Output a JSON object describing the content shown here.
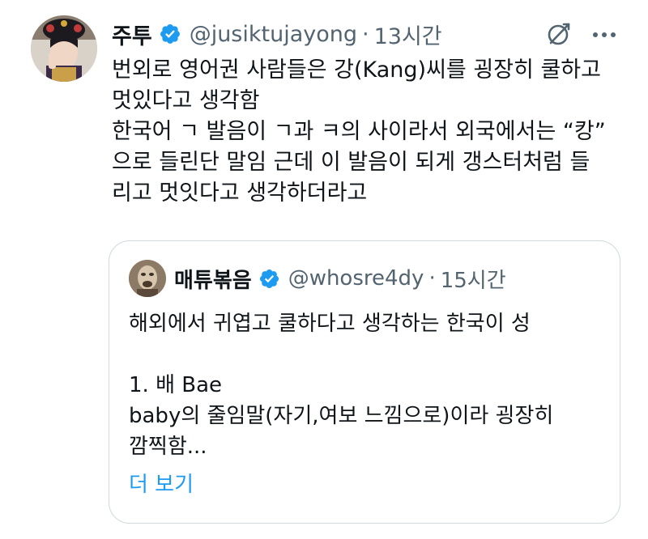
{
  "tweet": {
    "author_name": "주투",
    "handle": "@jusiktujayong",
    "separator": "·",
    "time": "13시간",
    "text_lines": [
      "번외로 영어권 사람들은 강(Kang)씨를 굉장히 쿨하고",
      "멋있다고 생각함",
      "한국어 ㄱ 발음이 ㄱ과 ㅋ의 사이라서 외국에서는 “캉”",
      "으로 들린단 말임 근데 이 발음이 되게 갱스터처럼 들",
      "리고 멋잇다고 생각하더라고"
    ],
    "icons": {
      "verified": "verified-badge-icon",
      "grok": "grok-icon",
      "more": "more-icon"
    }
  },
  "quote": {
    "author_name": "매튜볶음",
    "handle": "@whosre4dy",
    "separator": "·",
    "time": "15시간",
    "text_lines": [
      "해외에서 귀엽고 쿨하다고 생각하는 한국이 성",
      "",
      "1. 배 Bae",
      "baby의 줄임말(자기,여보 느낌으로)이라 굉장히",
      "깜찍함..."
    ],
    "show_more": "더 보기"
  },
  "colors": {
    "text": "#0f1419",
    "secondary": "#536471",
    "accent": "#1d9bf0",
    "border": "#cfd9de"
  }
}
